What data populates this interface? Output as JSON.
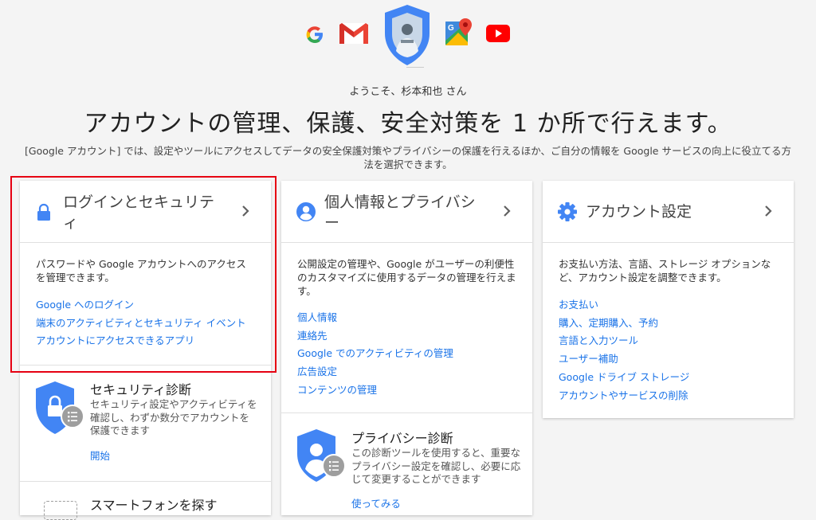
{
  "header": {
    "welcome": "ようこそ、杉本和也 さん",
    "headline": "アカウントの管理、保護、安全対策を 1 か所で行えます。",
    "description": "[Google アカウント] では、設定やツールにアクセスしてデータの安全保護対策やプライバシーの保護を行えるほか、ご自分の情報を Google サービスの向上に役立てる方法を選択できます。",
    "app_icons": [
      "google-g-icon",
      "gmail-icon",
      "profile-shield-icon",
      "maps-icon",
      "youtube-icon"
    ]
  },
  "cards": {
    "security": {
      "title": "ログインとセキュリティ",
      "description": "パスワードや Google アカウントへのアクセスを管理できます。",
      "links": [
        "Google へのログイン",
        "端末のアクティビティとセキュリティ イベント",
        "アカウントにアクセスできるアプリ"
      ],
      "checkup": {
        "title": "セキュリティ診断",
        "text": "セキュリティ設定やアクティビティを確認し、わずか数分でアカウントを保護できます",
        "link": "開始"
      },
      "find_phone": {
        "title": "スマートフォンを探す"
      }
    },
    "privacy": {
      "title": "個人情報とプライバシー",
      "description": "公開設定の管理や、Google がユーザーの利便性のカスタマイズに使用するデータの管理を行えます。",
      "links": [
        "個人情報",
        "連絡先",
        "Google でのアクティビティの管理",
        "広告設定",
        "コンテンツの管理"
      ],
      "checkup": {
        "title": "プライバシー診断",
        "text": "この診断ツールを使用すると、重要なプライバシー設定を確認し、必要に応じて変更することができます",
        "link": "使ってみる"
      }
    },
    "account": {
      "title": "アカウント設定",
      "description": "お支払い方法、言語、ストレージ オプションなど、アカウント設定を調整できます。",
      "links": [
        "お支払い",
        "購入、定期購入、予約",
        "言語と入力ツール",
        "ユーザー補助",
        "Google ドライブ ストレージ",
        "アカウントやサービスの削除"
      ]
    }
  },
  "colors": {
    "accent_blue": "#4285f4",
    "link_blue": "#1a73e8",
    "highlight_red": "#e60012"
  }
}
